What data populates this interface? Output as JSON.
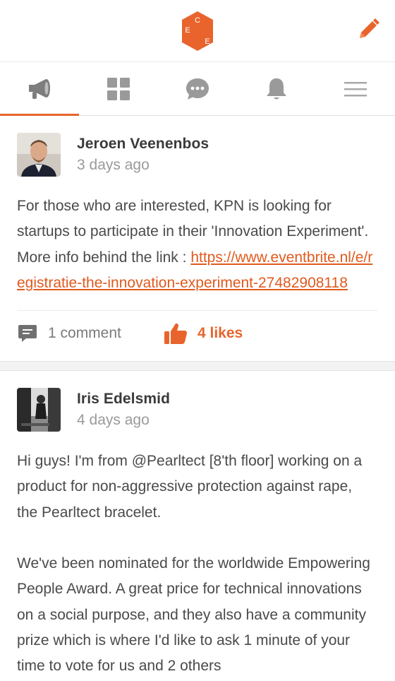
{
  "header": {
    "logo_letters": [
      "C",
      "E",
      "E"
    ],
    "brand_color": "#e8642c",
    "compose_icon": "pencil-icon"
  },
  "tabs": [
    {
      "name": "announcements",
      "icon": "megaphone-icon",
      "active": true
    },
    {
      "name": "dashboard",
      "icon": "grid-icon",
      "active": false
    },
    {
      "name": "messages",
      "icon": "chat-bubble-icon",
      "active": false
    },
    {
      "name": "notifications",
      "icon": "bell-icon",
      "active": false
    },
    {
      "name": "menu",
      "icon": "hamburger-menu-icon",
      "active": false
    }
  ],
  "posts": [
    {
      "author": "Jeroen Veenenbos",
      "time": "3 days ago",
      "text": "For those who are interested, KPN is looking for startups to participate in their 'Innovation Experiment'. More info behind the link : ",
      "link": "https://www.eventbrite.nl/e/registratie-the-innovation-experiment-27482908118",
      "comments": "1 comment",
      "likes": "4 likes"
    },
    {
      "author": "Iris Edelsmid",
      "time": "4 days ago",
      "paragraph_1": "Hi guys! I'm from @Pearltect [8'th floor] working on a product for non-aggressive protection against rape, the Pearltect bracelet.",
      "paragraph_2": "We've been nominated for the worldwide Empowering People Award. A great price for technical innovations on a social purpose, and they also have a community prize which is where I'd like to ask 1 minute of your time to vote for us and 2 others"
    }
  ]
}
